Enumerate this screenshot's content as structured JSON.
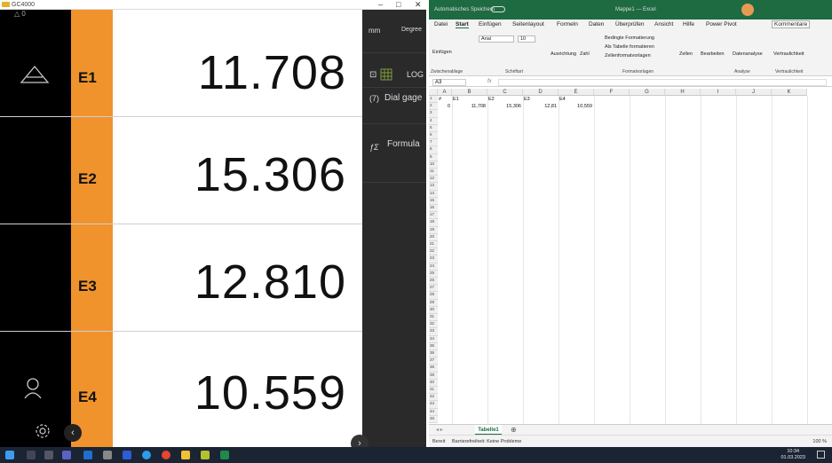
{
  "gc": {
    "title": "GC4000",
    "rail_top": "△ 0",
    "window_controls": {
      "minimize": "–",
      "maximize": "□",
      "close": "✕"
    },
    "axes": [
      {
        "label": "E1",
        "value": "11.708"
      },
      {
        "label": "E2",
        "value": "15.306"
      },
      {
        "label": "E3",
        "value": "12.810"
      },
      {
        "label": "E4",
        "value": "10.559"
      }
    ],
    "panel": {
      "unit": "mm",
      "angle": "Degree",
      "log": "LOG",
      "dial": "Dial gage",
      "formula": "Formula",
      "log_icon": "⊡",
      "dial_icon": "(7)",
      "formula_icon": "ƒΣ"
    },
    "arrows": {
      "left": "‹",
      "right": "›"
    }
  },
  "excel": {
    "title_left": "Automatisches Speichern",
    "title_center": "Mappe1 — Excel",
    "tabs": [
      "Datei",
      "Start",
      "Einfügen",
      "Seitenlayout",
      "Formeln",
      "Daten",
      "Überprüfen",
      "Ansicht",
      "Hilfe",
      "Power Pivot"
    ],
    "comments_btn": "Kommentare",
    "ribbon": {
      "paste": "Einfügen",
      "font": "Arial",
      "size": "10",
      "align": "Ausrichtung",
      "number": "Zahl",
      "cond": "Bedingte Formatierung",
      "table": "Als Tabelle formatieren",
      "styles": "Zellenformatvorlagen",
      "cells": "Zellen",
      "edit": "Bearbeiten",
      "analysis": "Datenanalyse",
      "sensitivity": "Vertraulichkeit",
      "g_clip": "Zwischenablage",
      "g_font": "Schriftart",
      "g_fmt": "Formatvorlagen",
      "g_an": "Analyse",
      "g_ver": "Vertraulichkeit"
    },
    "namebox": "A3",
    "fx": "fx",
    "columns": [
      "A",
      "B",
      "C",
      "D",
      "E",
      "F",
      "G",
      "H",
      "I",
      "J",
      "K"
    ],
    "row1": [
      "#",
      "E1",
      "E2",
      "E3",
      "E4"
    ],
    "row2": [
      "0",
      "11,708",
      "15,306",
      "12,81",
      "10,559"
    ],
    "row_count": 45,
    "sheet_tab": "Tabelle1",
    "add_sheet": "⊕",
    "status_left": "Bereit",
    "status_access": "Barrierefreiheit: Keine Probleme",
    "zoom": "100 %"
  },
  "taskbar": {
    "time": "10:34",
    "date": "01.03.2023"
  }
}
